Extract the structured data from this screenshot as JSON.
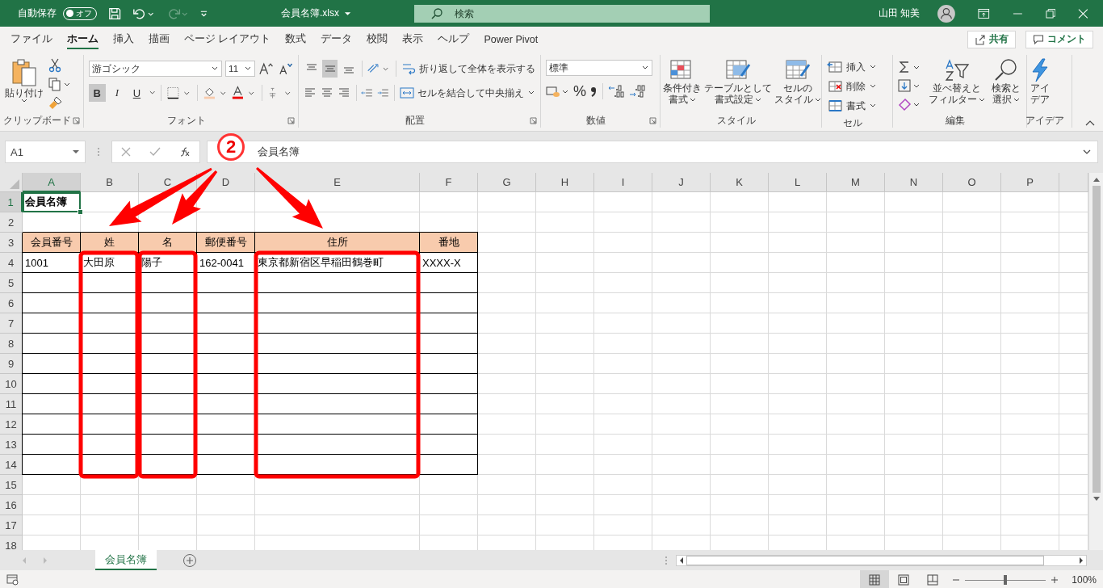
{
  "title_bar": {
    "autosave_label": "自動保存",
    "autosave_toggle": {
      "label": "オフ",
      "on": false
    },
    "redo_disabled": true,
    "file_name": "会員名簿.xlsx",
    "search": {
      "placeholder": "検索"
    },
    "user_name": "山田 知美"
  },
  "ribbon_tabs": [
    {
      "label": "ファイル",
      "selected": false
    },
    {
      "label": "ホーム",
      "selected": true
    },
    {
      "label": "挿入",
      "selected": false
    },
    {
      "label": "描画",
      "selected": false
    },
    {
      "label": "ページ レイアウト",
      "selected": false
    },
    {
      "label": "数式",
      "selected": false
    },
    {
      "label": "データ",
      "selected": false
    },
    {
      "label": "校閲",
      "selected": false
    },
    {
      "label": "表示",
      "selected": false
    },
    {
      "label": "ヘルプ",
      "selected": false
    },
    {
      "label": "Power Pivot",
      "selected": false
    }
  ],
  "share_button": "共有",
  "comment_button": "コメント",
  "ribbon": {
    "clipboard": {
      "label": "クリップボード",
      "paste": "貼り付け"
    },
    "font": {
      "label": "フォント",
      "font_name": "游ゴシック",
      "font_size": "11",
      "styles": [
        {
          "kind": "bold",
          "text": "B",
          "selected": true
        },
        {
          "kind": "italic",
          "text": "I",
          "selected": false
        },
        {
          "kind": "underline",
          "text": "U",
          "selected": false
        }
      ]
    },
    "alignment": {
      "label": "配置",
      "buttons": [
        {
          "kind": "top",
          "selected": false
        },
        {
          "kind": "middle",
          "selected": true
        },
        {
          "kind": "bottom",
          "selected": false
        },
        {
          "kind": "left",
          "selected": false
        },
        {
          "kind": "center",
          "selected": false
        },
        {
          "kind": "right",
          "selected": false
        }
      ],
      "wrap": "折り返して全体を表示する",
      "merge": "セルを結合して中央揃え"
    },
    "number": {
      "label": "数値",
      "format": "標準",
      "percent": "%"
    },
    "styles": {
      "label": "スタイル",
      "buttons": [
        {
          "kind": "conditional",
          "lines": [
            "条件付き",
            "書式"
          ]
        },
        {
          "kind": "table",
          "lines": [
            "テーブルとして",
            "書式設定"
          ]
        },
        {
          "kind": "cell",
          "lines": [
            "セルの",
            "スタイル"
          ]
        }
      ]
    },
    "cells": {
      "label": "セル",
      "buttons": [
        {
          "kind": "insert",
          "text": "挿入"
        },
        {
          "kind": "delete",
          "text": "削除"
        },
        {
          "kind": "format",
          "text": "書式"
        }
      ]
    },
    "editing": {
      "label": "編集",
      "buttons": [
        {
          "kind": "sort",
          "lines": [
            "並べ替えと",
            "フィルター"
          ]
        },
        {
          "kind": "find",
          "lines": [
            "検索と",
            "選択"
          ]
        }
      ]
    },
    "ideas": {
      "label": "アイデア",
      "lines": [
        "アイ",
        "デア"
      ]
    }
  },
  "formula_bar": {
    "name_box": "A1",
    "formula": "会員名簿"
  },
  "annotation": {
    "marker": "2"
  },
  "sheet": {
    "columns": [
      "A",
      "B",
      "C",
      "D",
      "E",
      "F",
      "G",
      "H",
      "I",
      "J",
      "K",
      "L",
      "M",
      "N",
      "O",
      "P"
    ],
    "rows": [
      {
        "number": "1",
        "cells": [
          {
            "text": "会員名簿",
            "bold": true,
            "selected": true
          }
        ]
      },
      {
        "number": "2"
      },
      {
        "number": "3",
        "in_table": true,
        "cells": [
          {
            "text": "会員番号",
            "kind": "header"
          },
          {
            "text": "姓",
            "kind": "header"
          },
          {
            "text": "名",
            "kind": "header"
          },
          {
            "text": "郵便番号",
            "kind": "header"
          },
          {
            "text": "住所",
            "kind": "header"
          },
          {
            "text": "番地",
            "kind": "header"
          }
        ]
      },
      {
        "number": "4",
        "in_table": true,
        "cells": [
          {
            "text": "1001"
          },
          {
            "text": "大田原"
          },
          {
            "text": "陽子"
          },
          {
            "text": "162-0041"
          },
          {
            "text": "東京都新宿区早稲田鶴巻町"
          },
          {
            "text": "XXXX-X"
          }
        ]
      },
      {
        "number": "5",
        "in_table": true
      },
      {
        "number": "6",
        "in_table": true
      },
      {
        "number": "7",
        "in_table": true
      },
      {
        "number": "8",
        "in_table": true
      },
      {
        "number": "9",
        "in_table": true
      },
      {
        "number": "10",
        "in_table": true
      },
      {
        "number": "11",
        "in_table": true
      },
      {
        "number": "12",
        "in_table": true
      },
      {
        "number": "13",
        "in_table": true
      },
      {
        "number": "14",
        "in_table": true
      },
      {
        "number": "15"
      },
      {
        "number": "16"
      },
      {
        "number": "17"
      },
      {
        "number": "18"
      }
    ]
  },
  "sheet_tabs": [
    {
      "label": "会員名簿",
      "selected": true
    }
  ],
  "status_bar": {
    "views": [
      {
        "kind": "normal",
        "selected": true
      },
      {
        "kind": "page_layout",
        "selected": false
      },
      {
        "kind": "page_break",
        "selected": false
      }
    ],
    "zoom": {
      "level": 0.5,
      "text": "100%"
    }
  }
}
